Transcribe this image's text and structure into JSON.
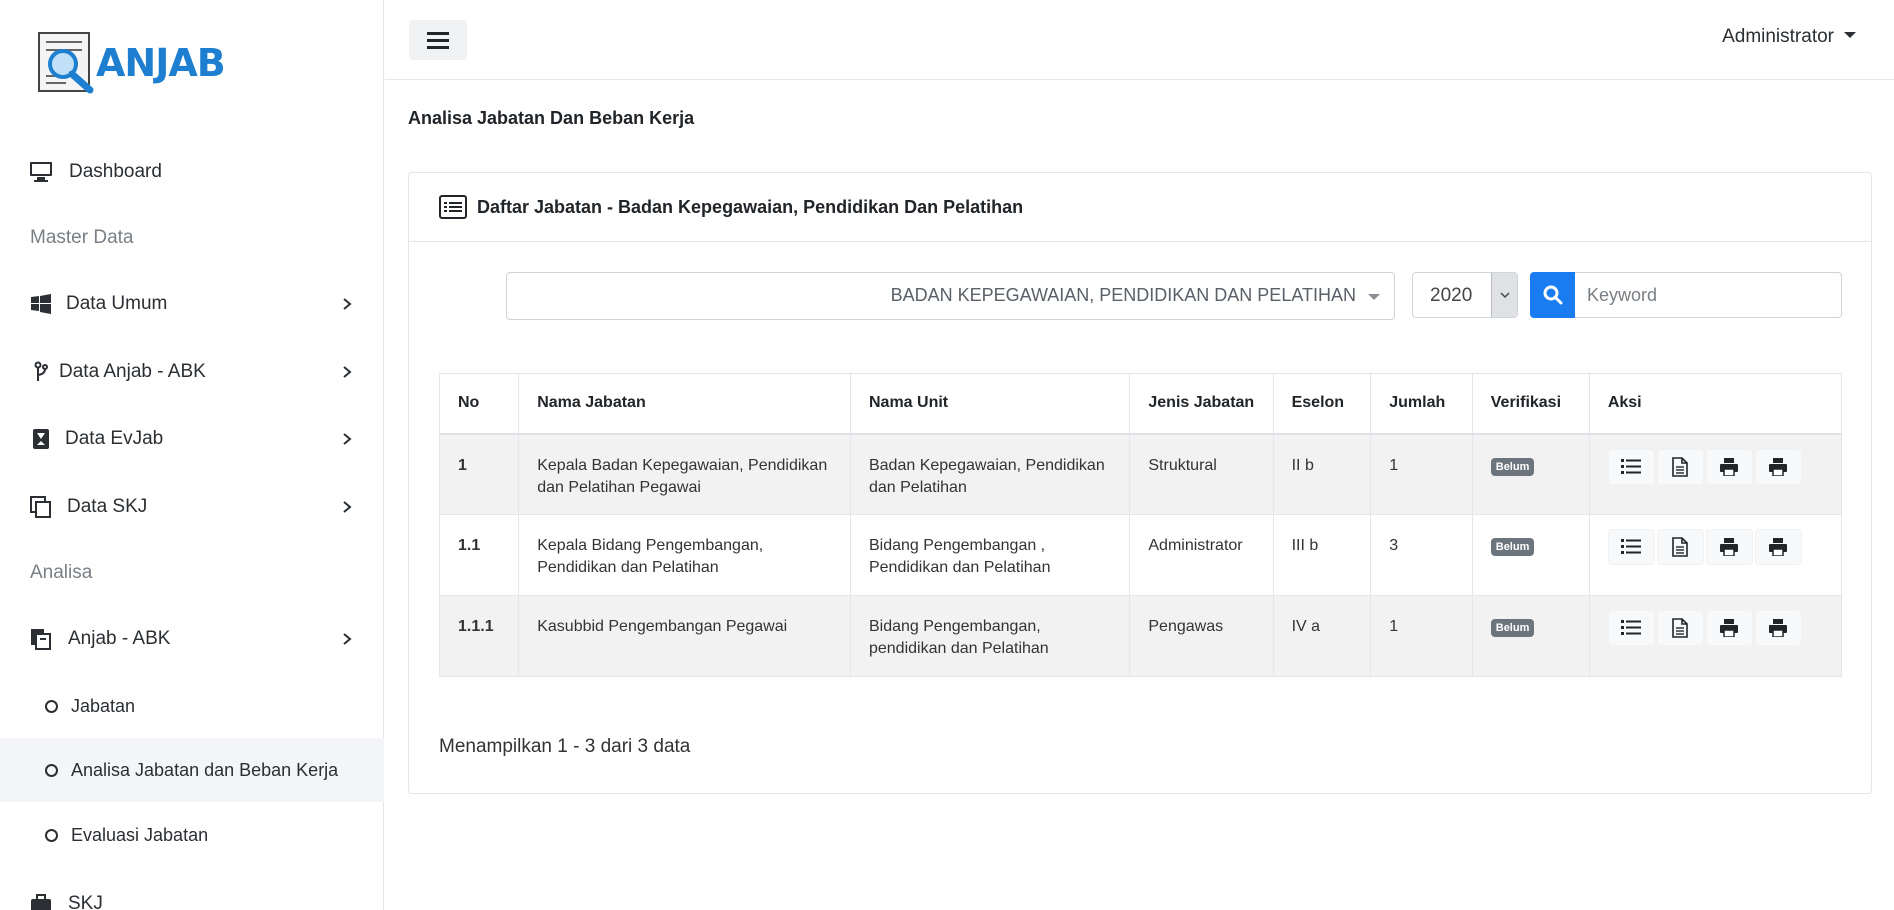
{
  "app": {
    "logo_text": "ANJAB"
  },
  "sidebar": {
    "dashboard": "Dashboard",
    "master_header": "Master Data",
    "data_umum": "Data Umum",
    "data_anjab": "Data Anjab - ABK",
    "data_evjab": "Data EvJab",
    "data_skj": "Data SKJ",
    "analisa_header": "Analisa",
    "anjab_abk": "Anjab - ABK",
    "sub": {
      "jabatan": "Jabatan",
      "analisa": "Analisa Jabatan dan Beban Kerja",
      "evaluasi": "Evaluasi Jabatan"
    },
    "skj": "SKJ"
  },
  "topbar": {
    "user": "Administrator"
  },
  "page": {
    "title": "Analisa Jabatan Dan Beban Kerja"
  },
  "card": {
    "title": "Daftar Jabatan - Badan Kepegawaian, Pendidikan Dan Pelatihan",
    "unit_select": "BADAN KEPEGAWAIAN, PENDIDIKAN DAN PELATIHAN",
    "year_select": "2020",
    "search_placeholder": "Keyword"
  },
  "table": {
    "headers": [
      "No",
      "Nama Jabatan",
      "Nama Unit",
      "Jenis Jabatan",
      "Eselon",
      "Jumlah",
      "Verifikasi",
      "Aksi"
    ],
    "rows": [
      {
        "no": "1",
        "nama": "Kepala Badan Kepegawaian, Pendidikan dan Pelatihan Pegawai",
        "unit": "Badan Kepegawaian, Pendidikan dan Pelatihan",
        "jenis": "Struktural",
        "eselon": "II b",
        "jumlah": "1",
        "verifikasi": "Belum"
      },
      {
        "no": "1.1",
        "nama": "Kepala Bidang Pengembangan, Pendidikan dan Pelatihan",
        "unit": "Bidang Pengembangan , Pendidikan dan Pelatihan",
        "jenis": "Administrator",
        "eselon": "III b",
        "jumlah": "3",
        "verifikasi": "Belum"
      },
      {
        "no": "1.1.1",
        "nama": "Kasubbid Pengembangan Pegawai",
        "unit": "Bidang Pengembangan, pendidikan dan Pelatihan",
        "jenis": "Pengawas",
        "eselon": "IV a",
        "jumlah": "1",
        "verifikasi": "Belum"
      }
    ]
  },
  "footer": {
    "info": "Menampilkan 1 - 3 dari 3 data"
  },
  "colors": {
    "brand": "#1e7fd0",
    "primary": "#1a7cf1",
    "badge": "#6c757d"
  }
}
